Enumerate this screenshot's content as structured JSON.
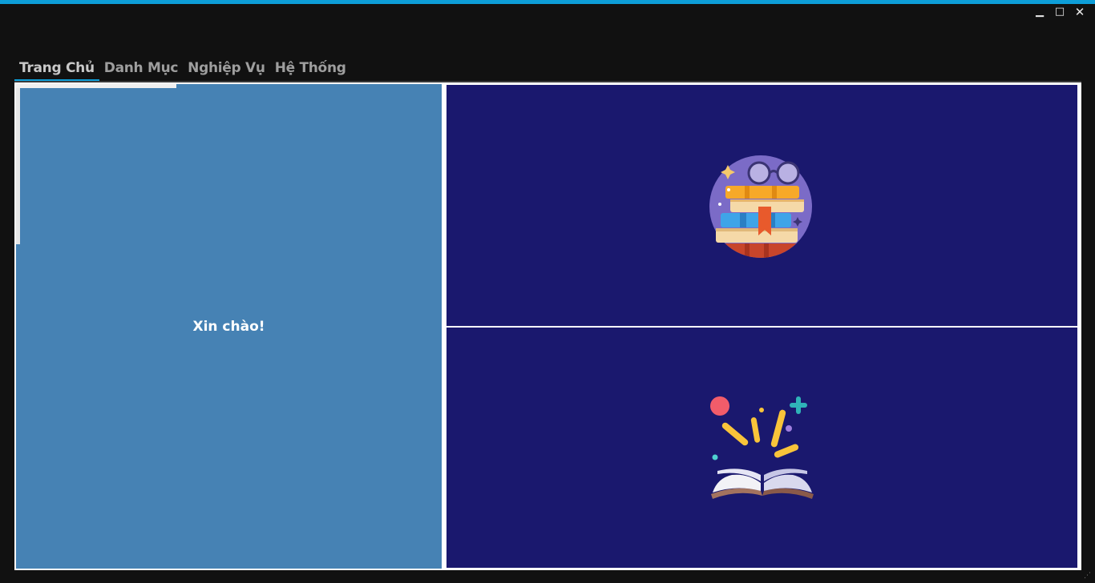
{
  "window": {
    "minimize_icon": "minimize-icon",
    "maximize_icon": "maximize-icon",
    "close_icon": "close-icon",
    "accent_color": "#0d9ed8",
    "background": "#111111"
  },
  "tabs": [
    {
      "label": "Trang Chủ",
      "active": true
    },
    {
      "label": "Danh Mục",
      "active": false
    },
    {
      "label": "Nghiệp Vụ",
      "active": false
    },
    {
      "label": "Hệ Thống",
      "active": false
    }
  ],
  "home": {
    "greeting": "Xin chào!",
    "left_panel_color": "#4682b4",
    "right_panel_color": "#1a186e",
    "top_illustration": "books-stack-glasses-icon",
    "bottom_illustration": "open-book-sparkle-icon"
  }
}
